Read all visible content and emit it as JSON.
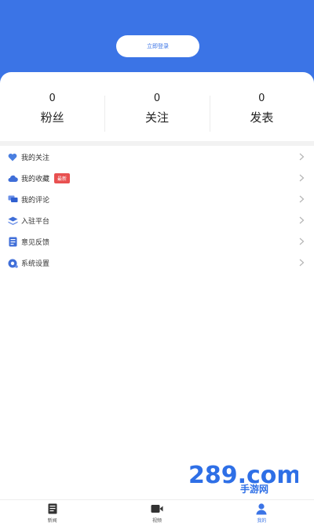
{
  "header": {
    "login_label": "立即登录"
  },
  "stats": [
    {
      "value": "0",
      "label": "粉丝"
    },
    {
      "value": "0",
      "label": "关注"
    },
    {
      "value": "0",
      "label": "发表"
    }
  ],
  "menu": {
    "items": [
      {
        "label": "我的关注",
        "icon": "heart-icon"
      },
      {
        "label": "我的收藏",
        "icon": "cloud-icon",
        "badge": "最新"
      },
      {
        "label": "我的评论",
        "icon": "comment-icon"
      },
      {
        "label": "入驻平台",
        "icon": "layers-icon"
      },
      {
        "label": "意见反馈",
        "icon": "feedback-icon"
      },
      {
        "label": "系统设置",
        "icon": "settings-icon"
      }
    ]
  },
  "tabbar": {
    "items": [
      {
        "label": "新闻",
        "icon": "document-icon",
        "active": false
      },
      {
        "label": "视频",
        "icon": "video-icon",
        "active": false
      },
      {
        "label": "我的",
        "icon": "user-icon",
        "active": true
      }
    ]
  },
  "watermark": {
    "text": "289.com",
    "subtext": "手游网"
  },
  "colors": {
    "accent": "#3b74e6",
    "badge": "#e85050",
    "background": "#ffffff"
  }
}
